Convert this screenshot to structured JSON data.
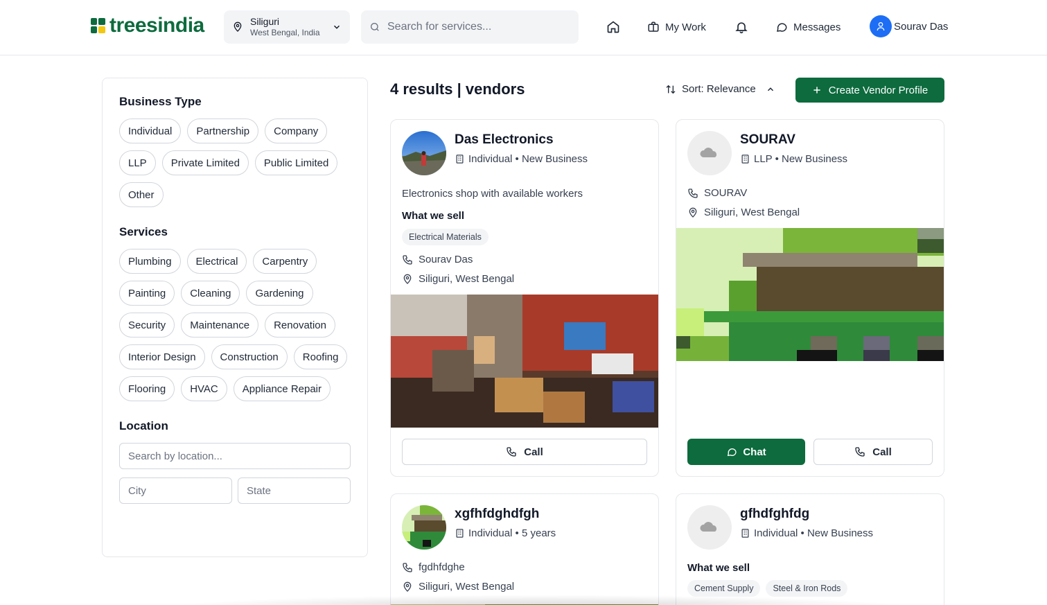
{
  "header": {
    "brand": "treesindia",
    "location": {
      "city": "Siliguri",
      "state": "West Bengal, India"
    },
    "search_placeholder": "Search for services...",
    "nav": {
      "my_work": "My Work",
      "messages": "Messages",
      "user_name": "Sourav Das"
    }
  },
  "sidebar": {
    "business_type_title": "Business Type",
    "business_types": [
      "Individual",
      "Partnership",
      "Company",
      "LLP",
      "Private Limited",
      "Public Limited",
      "Other"
    ],
    "services_title": "Services",
    "services": [
      "Plumbing",
      "Electrical",
      "Carpentry",
      "Painting",
      "Cleaning",
      "Gardening",
      "Security",
      "Maintenance",
      "Renovation",
      "Interior Design",
      "Construction",
      "Roofing",
      "Flooring",
      "HVAC",
      "Appliance Repair"
    ],
    "location_title": "Location",
    "location_placeholder": "Search by location...",
    "city_placeholder": "City",
    "state_placeholder": "State"
  },
  "main": {
    "results_title": "4 results | vendors",
    "sort_label": "Sort: Relevance",
    "create_label": "Create Vendor Profile"
  },
  "vendors": [
    {
      "name": "Das Electronics",
      "meta": "Individual • New Business",
      "description": "Electronics shop with available workers",
      "sell_title": "What we sell",
      "tags": [
        "Electrical Materials"
      ],
      "contact": "Sourav Das",
      "location": "Siliguri, West Bengal",
      "call_label": "Call"
    },
    {
      "name": "SOURAV",
      "meta": "LLP • New Business",
      "contact": "SOURAV",
      "location": "Siliguri, West Bengal",
      "chat_label": "Chat",
      "call_label": "Call"
    },
    {
      "name": "xgfhfdghdfgh",
      "meta": "Individual • 5 years",
      "contact": "fgdhfdghe",
      "location": "Siliguri, West Bengal"
    },
    {
      "name": "gfhdfghfdg",
      "meta": "Individual • New Business",
      "sell_title": "What we sell",
      "tags": [
        "Cement Supply",
        "Steel & Iron Rods"
      ]
    }
  ],
  "colors": {
    "brand_green": "#0d6b3e",
    "avatar_blue": "#1d6ef5"
  }
}
